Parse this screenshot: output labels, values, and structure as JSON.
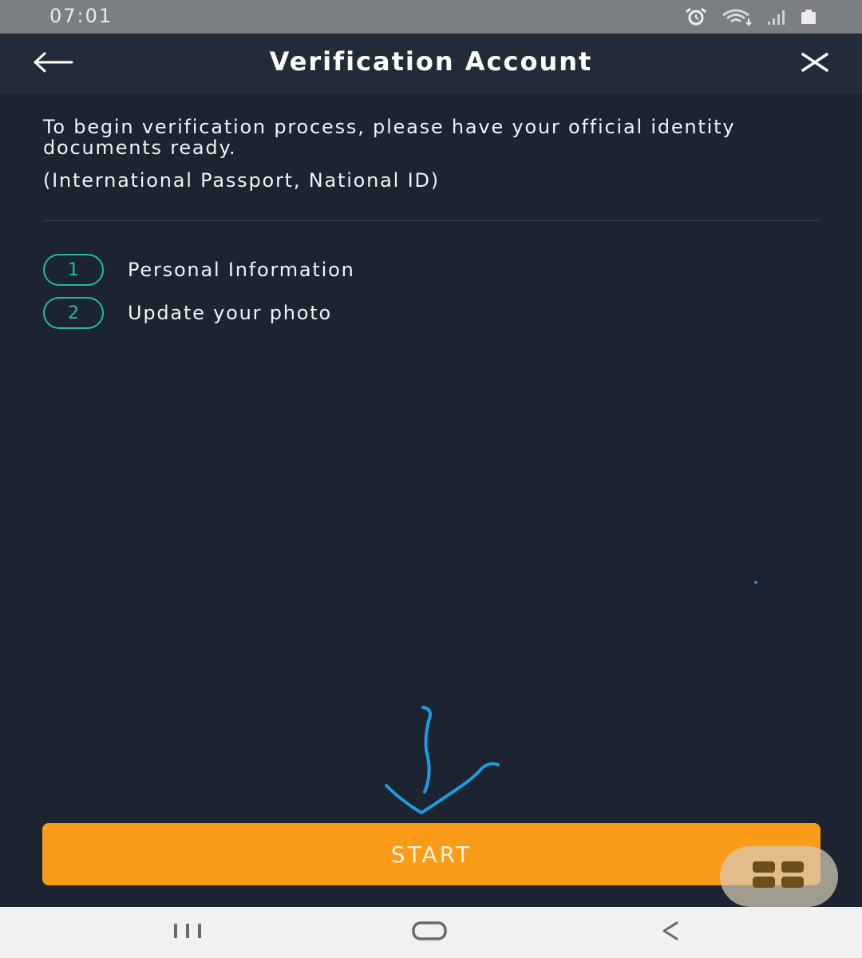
{
  "status_bar": {
    "time": "07:01",
    "icons": [
      "alarm-icon",
      "wifi-icon",
      "signal-icon",
      "battery-icon"
    ]
  },
  "header": {
    "title": "Verification Account",
    "back_icon": "arrow-left-icon",
    "close_icon": "close-icon"
  },
  "content": {
    "intro": "To begin verification process, please have your official identity documents ready.",
    "document_types": "(International Passport, National ID)",
    "steps": [
      {
        "number": "1",
        "label": "Personal Information"
      },
      {
        "number": "2",
        "label": "Update your photo"
      }
    ]
  },
  "start_button": {
    "label": "START"
  },
  "floating_button": {
    "icon": "grid-menu-icon"
  },
  "nav_bar": {
    "icons": [
      "recent-apps-icon",
      "home-icon",
      "back-icon"
    ]
  },
  "colors": {
    "background": "#1b2430",
    "header": "#222c39",
    "accent_teal": "#25b99a",
    "start_orange": "#fb9b1a",
    "status_bar": "#7b7f84",
    "nav_bar": "#f1f1f1",
    "annotation_blue": "#1e9be0"
  }
}
